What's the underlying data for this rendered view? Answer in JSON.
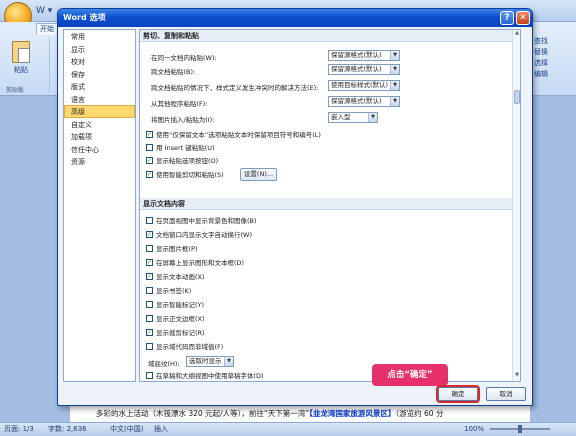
{
  "word": {
    "qat_glyphs": "W ▾",
    "tab_start": "开始",
    "paste_label": "粘贴",
    "clipboard_group": "剪贴板",
    "right_group": [
      "查找",
      "替换",
      "选择",
      "编辑"
    ],
    "doc_text_prefix": "多彩的水上活动（木筏漂水 320 元起/人等），前往“天下第一湾”",
    "doc_text_link": "【韭龙湾国家旅游风景区】",
    "doc_text_suffix": "（游览约 60 分"
  },
  "status_bar": {
    "page": "页面: 1/3",
    "words": "字数: 2,636",
    "lang": "中文(中国)",
    "mode": "插入",
    "zoom": "100%"
  },
  "dialog": {
    "title": "Word 选项",
    "help": "?",
    "close": "✕",
    "nav": [
      "常用",
      "显示",
      "校对",
      "保存",
      "版式",
      "语言",
      "高级",
      "自定义",
      "加载项",
      "信任中心",
      "资源"
    ],
    "selected_nav": "高级",
    "section_cut": "剪切、复制和粘贴",
    "paste_rows": [
      {
        "label": "在同一文档内粘贴(W):",
        "value": "保留源格式(默认)"
      },
      {
        "label": "跨文档粘贴(B):",
        "value": "保留源格式(默认)"
      },
      {
        "label": "跨文档粘贴的情况下，样式定义发生冲突时的解决方法(E):",
        "value": "使用目标样式(默认)"
      },
      {
        "label": "从其他程序粘贴(F):",
        "value": "保留源格式(默认)"
      },
      {
        "label": "将图片插入/粘贴为(I):",
        "value": "嵌入型"
      }
    ],
    "paste_checks": [
      {
        "label": "使用“仅保留文本”选项粘贴文本时保留项目符号和编号(L)",
        "checked": true
      },
      {
        "label": "用 Insert 键粘贴(U)",
        "checked": false
      },
      {
        "label": "显示粘贴选项按钮(O)",
        "checked": true
      },
      {
        "label": "使用智能剪切和粘贴(S)",
        "checked": true
      }
    ],
    "settings_button": "设置(N)...",
    "section_display": "显示文档内容",
    "display_checks": [
      {
        "label": "在页面视图中显示背景色和图像(B)",
        "checked": false
      },
      {
        "label": "文档窗口内显示文字自动换行(W)",
        "checked": true
      },
      {
        "label": "显示图片框(P)",
        "checked": false
      },
      {
        "label": "在屏幕上显示图形和文本框(D)",
        "checked": true
      },
      {
        "label": "显示文本动画(X)",
        "checked": true
      },
      {
        "label": "显示书签(K)",
        "checked": false
      },
      {
        "label": "显示智能标记(Y)",
        "checked": false
      },
      {
        "label": "显示正文边框(X)",
        "checked": false
      },
      {
        "label": "显示裁剪标记(R)",
        "checked": true
      },
      {
        "label": "显示域代码而非域值(F)",
        "checked": false
      }
    ],
    "field_shading_label": "域底纹(H):",
    "field_shading_value": "选取时显示",
    "draft_check": "在草稿和大纲视图中使用草稿字体(D)",
    "ok": "确定",
    "cancel": "取消",
    "callout": "点击“确定”"
  },
  "colors": {
    "title_blue": "#0b4fcf",
    "selected_nav": "#ffd970",
    "callout": "#e6316a",
    "ok_highlight": "#d62b2b"
  }
}
